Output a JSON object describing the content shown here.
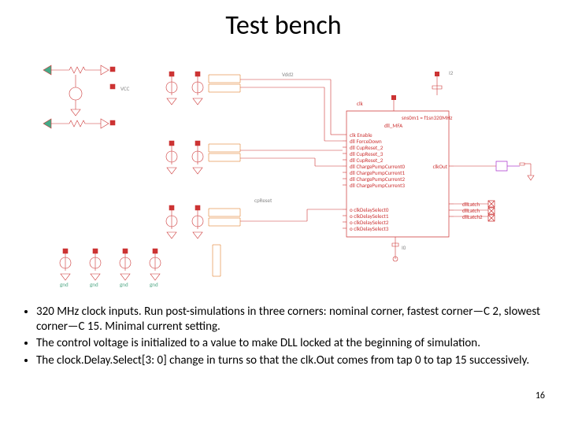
{
  "title": "Test bench",
  "bullets": [
    "320 MHz clock inputs. Run post-simulations in three corners: nominal corner, fastest corner—C 2, slowest corner—C 15. Minimal current setting.",
    "The control voltage is initialized to a value to make DLL locked at the beginning of simulation.",
    "The clock.Delay.Select[3: 0] change in turns so that the clk.Out comes from tap 0 to tap 15 successively."
  ],
  "page_number": "16",
  "diagram": {
    "block_inputs": [
      "clk Enable",
      "dll ForceDown",
      "dll CupReset_2",
      "dll CupReset_3",
      "dll CupReset_2",
      "dll ChargePumpCurrent0",
      "dll ChargePumpCurrent1",
      "dll ChargePumpCurrent2",
      "dll ChargePumpCurrent3"
    ],
    "block_outputs_left": [
      "o clkDelaySelect0",
      "o clkDelaySelect1",
      "o clkDelaySelect2",
      "o clkDelaySelect3"
    ],
    "block_right_out": "clkOut",
    "block_right_group": [
      "dllLatch",
      "dllLatch",
      "dllLatch2"
    ],
    "block_top": "clk",
    "block_header1": "sns0m1 = f1sn320MHz",
    "block_header2": "dll_MFA",
    "annot_vcc": "VCC",
    "annot_vdd2": "Vdd2",
    "annot_gnd": "gnd",
    "annot_cpreset": "cpReset",
    "annot_i0": "I0",
    "annot_i2": "I2"
  }
}
